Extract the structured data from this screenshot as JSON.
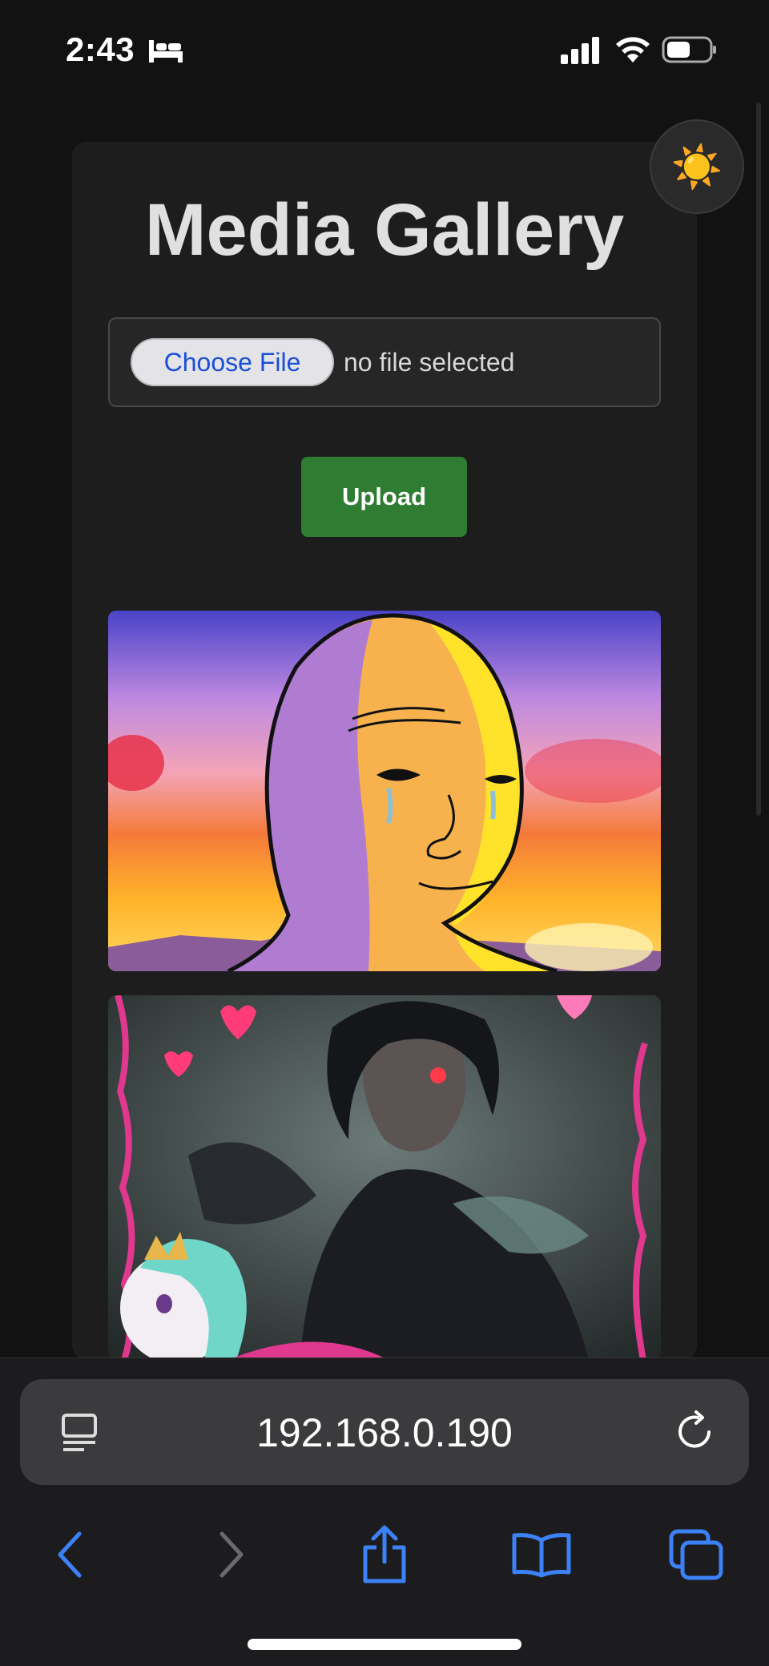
{
  "status_bar": {
    "time": "2:43",
    "icons": [
      "bed-icon",
      "signal-icon",
      "wifi-icon",
      "battery-icon"
    ]
  },
  "theme_toggle": {
    "icon": "☀️"
  },
  "page": {
    "title": "Media Gallery",
    "file_input": {
      "button_label": "Choose File",
      "status": "no file selected"
    },
    "upload_label": "Upload"
  },
  "browser": {
    "address": "192.168.0.190",
    "icons": [
      "reader-icon",
      "reload-icon",
      "back-icon",
      "forward-icon",
      "share-icon",
      "bookmarks-icon",
      "tabs-icon"
    ]
  },
  "colors": {
    "background": "#121212",
    "card": "#1d1d1d",
    "upload_button": "#2e7d32",
    "link_blue": "#1a4fd6",
    "toolbar_blue": "#3c82f6"
  }
}
